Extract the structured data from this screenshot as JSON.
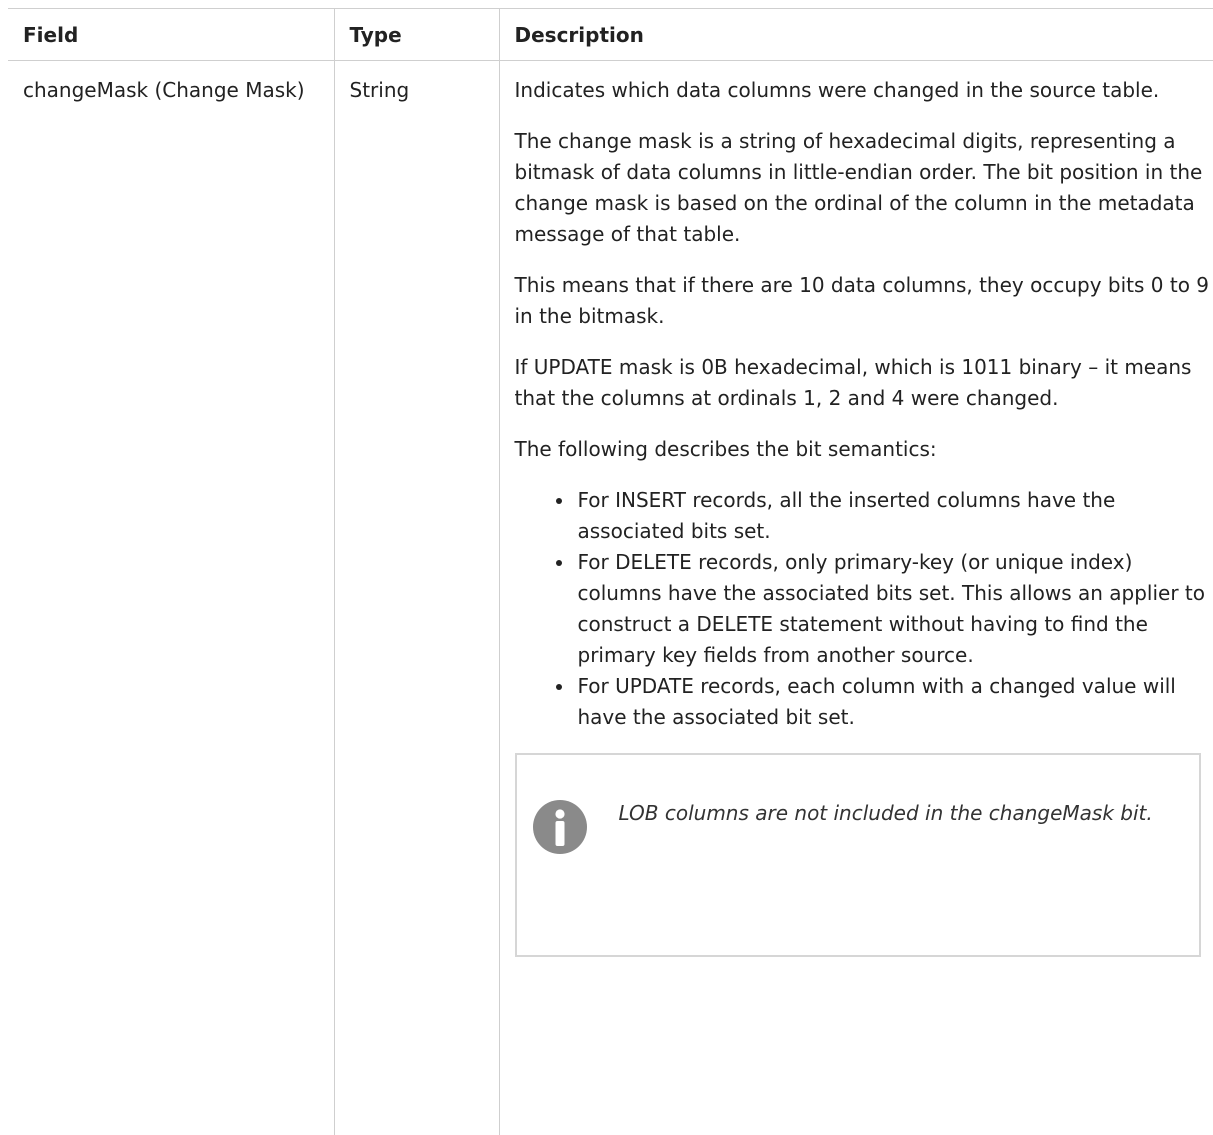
{
  "table": {
    "headers": {
      "field": "Field",
      "type": "Type",
      "description": "Description"
    },
    "rows": [
      {
        "field": "changeMask (Change Mask)",
        "type": "String",
        "description": {
          "paragraphs": [
            "Indicates which data columns were changed in the source table.",
            "The change mask is a string of hexadecimal digits, representing a bitmask of data columns in little-endian order. The bit position in the change mask is based on the ordinal of the column in the metadata message of that table.",
            "This means that if there are 10 data columns, they occupy bits 0 to 9 in the bitmask.",
            "If UPDATE mask is 0B hexadecimal, which is 1011 binary – it means that the columns at ordinals 1, 2 and 4 were changed.",
            "The following describes the bit semantics:"
          ],
          "bullets": [
            "For INSERT records, all the inserted columns have the associated bits set.",
            "For DELETE records, only primary-key (or unique index) columns have the associated bits set. This allows an applier to construct a DELETE statement without having to find the primary key fields from another source.",
            "For UPDATE records, each column with a changed value will have the associated bit set."
          ],
          "note": {
            "icon": "info-icon",
            "text": "LOB columns are not included in the changeMask bit."
          }
        }
      }
    ]
  },
  "colors": {
    "border": "#cfcfcf",
    "note_border": "#d6d6d6",
    "icon_fill": "#8a8a8a"
  }
}
